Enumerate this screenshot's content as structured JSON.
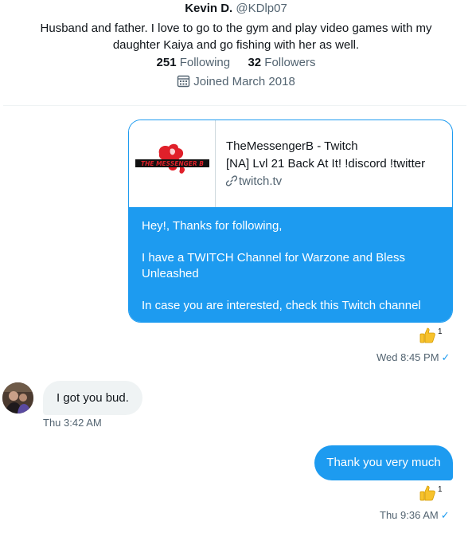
{
  "profile": {
    "display_name": "Kevin D.",
    "handle": "@KDlp07",
    "bio": "Husband and father. I love to go to the gym and play video games with my daughter Kaiya and go fishing with her as well.",
    "following_count": "251",
    "following_label": "Following",
    "followers_count": "32",
    "followers_label": "Followers",
    "joined": "Joined March 2018"
  },
  "messages": [
    {
      "direction": "outgoing",
      "card": {
        "logo_text": "THE MESSENGER B",
        "title": "TheMessengerB - Twitch",
        "description": "[NA] Lvl 21 Back At It! !discord !twitter",
        "domain": "twitch.tv"
      },
      "paragraphs": [
        "Hey!, Thanks for following,",
        "I have a TWITCH Channel for Warzone and Bless Unleashed",
        "In case you are interested, check this Twitch channel"
      ],
      "reaction": {
        "emoji": "thumbs-up",
        "count": "1"
      },
      "timestamp": "Wed 8:45 PM",
      "status_icon": "check-icon"
    },
    {
      "direction": "incoming",
      "text": "I got you bud.",
      "timestamp": "Thu 3:42 AM"
    },
    {
      "direction": "outgoing",
      "text": "Thank you very much",
      "reaction": {
        "emoji": "thumbs-up",
        "count": "1"
      },
      "timestamp": "Thu 9:36 AM",
      "status_icon": "check-icon"
    }
  ],
  "colors": {
    "accent": "#1d9bf0",
    "incoming_bubble": "#eff3f4",
    "secondary_text": "#536471",
    "primary_text": "#0f1419"
  }
}
